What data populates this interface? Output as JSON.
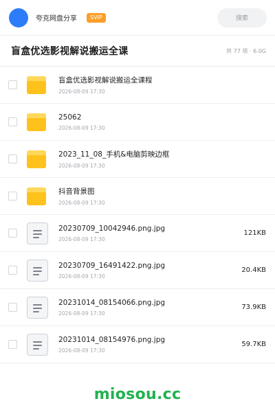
{
  "header": {
    "share_name": "夸克网盘分享",
    "badge": "SVIP",
    "search_placeholder": "搜索"
  },
  "folder": {
    "title": "盲盒优选影视解说搬运全课",
    "summary": "共 77 项 · 6.0G"
  },
  "files": [
    {
      "type": "folder",
      "icon": "folder-icon",
      "name": "盲盒优选影视解说搬运全课程",
      "date": "2026-08-09 17:30",
      "size": ""
    },
    {
      "type": "folder",
      "icon": "folder-icon",
      "name": "25062",
      "date": "2026-08-09 17:30",
      "size": ""
    },
    {
      "type": "folder",
      "icon": "folder-icon",
      "name": "2023_11_08_手机&电脑剪映边框",
      "date": "2026-08-09 17:30",
      "size": ""
    },
    {
      "type": "folder",
      "icon": "folder-icon",
      "name": "抖音背景图",
      "date": "2026-08-09 17:30",
      "size": ""
    },
    {
      "type": "file",
      "icon": "document-icon",
      "name": "20230709_10042946.png.jpg",
      "date": "2026-08-09 17:30",
      "size": "121KB"
    },
    {
      "type": "file",
      "icon": "document-icon",
      "name": "20230709_16491422.png.jpg",
      "date": "2026-08-09 17:30",
      "size": "20.4KB"
    },
    {
      "type": "file",
      "icon": "document-icon",
      "name": "20231014_08154066.png.jpg",
      "date": "2026-08-09 17:30",
      "size": "73.9KB"
    },
    {
      "type": "file",
      "icon": "document-icon",
      "name": "20231014_08154976.png.jpg",
      "date": "2026-08-09 17:30",
      "size": "59.7KB"
    }
  ],
  "watermark": "miosou.cc",
  "colors": {
    "avatar": "#2d7dfa",
    "badge": "#fb9f2a",
    "folder": "#ffc21c",
    "watermark": "#21b24f"
  }
}
